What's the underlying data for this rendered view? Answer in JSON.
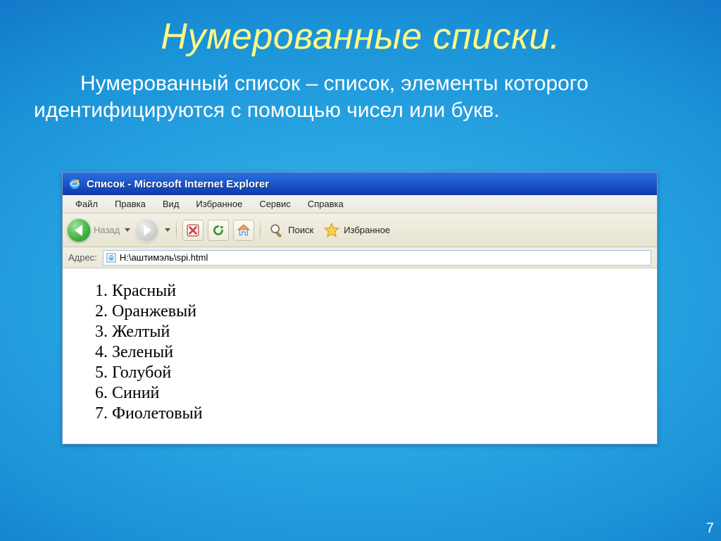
{
  "slide": {
    "title": "Нумерованные списки.",
    "body": "Нумерованный список – список, элементы которого идентифицируются с помощью чисел или букв.",
    "page_number": "7"
  },
  "browser": {
    "title": "Список - Microsoft Internet Explorer",
    "menu": {
      "file": "Файл",
      "edit": "Правка",
      "view": "Вид",
      "favorites": "Избранное",
      "tools": "Сервис",
      "help": "Справка"
    },
    "toolbar": {
      "back": "Назад",
      "search": "Поиск",
      "favorites": "Избранное"
    },
    "address_label": "Адрес:",
    "address_value": "H:\\аштимэль\\spi.html"
  },
  "list_items": [
    "Красный",
    "Оранжевый",
    "Желтый",
    "Зеленый",
    "Голубой",
    "Синий",
    "Фиолетовый"
  ]
}
